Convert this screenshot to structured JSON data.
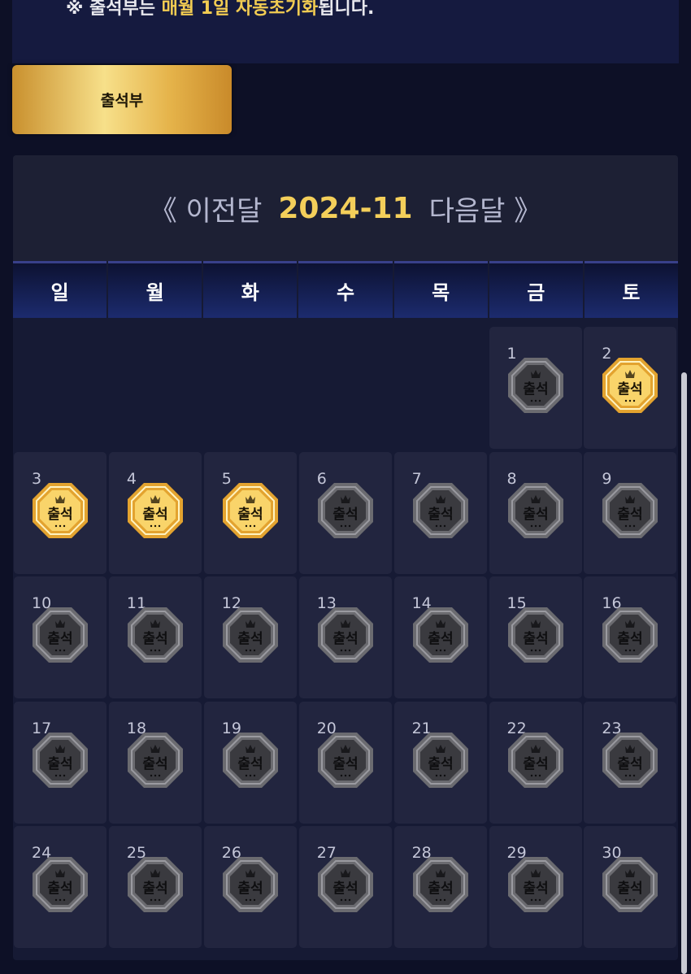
{
  "notice": {
    "prefix": "※ 출석부는 ",
    "highlight": "매월 1일 자동초기화",
    "suffix": "됩니다."
  },
  "tab": {
    "label": "출석부"
  },
  "calendar": {
    "prev_label": "《 이전달",
    "month": "2024-11",
    "next_label": "다음달 》",
    "weekdays": [
      "일",
      "월",
      "화",
      "수",
      "목",
      "금",
      "토"
    ],
    "badge_label": "출석",
    "first_weekday": 5,
    "days": [
      {
        "day": "1",
        "attended": false
      },
      {
        "day": "2",
        "attended": true
      },
      {
        "day": "3",
        "attended": true
      },
      {
        "day": "4",
        "attended": true
      },
      {
        "day": "5",
        "attended": true
      },
      {
        "day": "6",
        "attended": false
      },
      {
        "day": "7",
        "attended": false
      },
      {
        "day": "8",
        "attended": false
      },
      {
        "day": "9",
        "attended": false
      },
      {
        "day": "10",
        "attended": false
      },
      {
        "day": "11",
        "attended": false
      },
      {
        "day": "12",
        "attended": false
      },
      {
        "day": "13",
        "attended": false
      },
      {
        "day": "14",
        "attended": false
      },
      {
        "day": "15",
        "attended": false
      },
      {
        "day": "16",
        "attended": false
      },
      {
        "day": "17",
        "attended": false
      },
      {
        "day": "18",
        "attended": false
      },
      {
        "day": "19",
        "attended": false
      },
      {
        "day": "20",
        "attended": false
      },
      {
        "day": "21",
        "attended": false
      },
      {
        "day": "22",
        "attended": false
      },
      {
        "day": "23",
        "attended": false
      },
      {
        "day": "24",
        "attended": false
      },
      {
        "day": "25",
        "attended": false
      },
      {
        "day": "26",
        "attended": false
      },
      {
        "day": "27",
        "attended": false
      },
      {
        "day": "28",
        "attended": false
      },
      {
        "day": "29",
        "attended": false
      },
      {
        "day": "30",
        "attended": false
      }
    ]
  },
  "colors": {
    "gold_outer": "#e3a32f",
    "gold_inner": "#f9d46a",
    "silver_outer": "#6b6b70",
    "silver_inner": "#3a3a3f",
    "month_accent": "#f4cf5a"
  },
  "icons": {
    "badge": "octagon-attendance-badge-icon"
  }
}
